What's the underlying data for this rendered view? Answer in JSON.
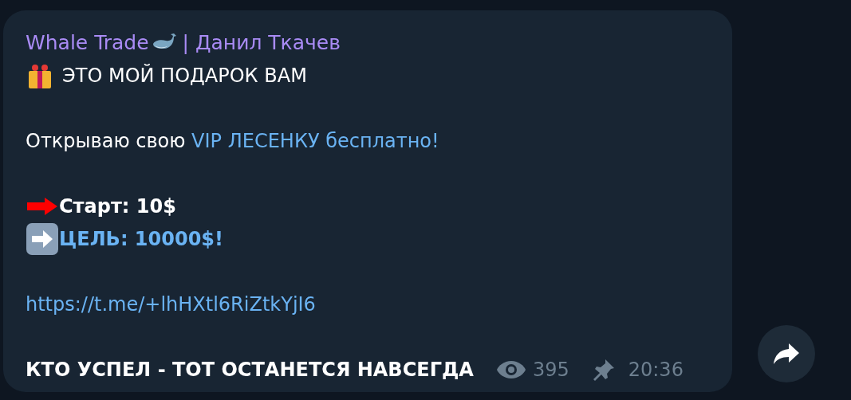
{
  "message": {
    "channel": "Whale Trade",
    "author": "| Данил Ткачев",
    "lines": [
      {
        "kind": "gift",
        "text": "ЭТО МОЙ ПОДАРОК ВАМ"
      },
      {
        "kind": "blank"
      },
      {
        "kind": "mixed",
        "text": "Открываю свою",
        "link": "VIP ЛЕСЕНКУ бесплатно!"
      },
      {
        "kind": "blank"
      },
      {
        "kind": "start",
        "text": "Старт: 10$"
      },
      {
        "kind": "goal",
        "text": "ЦЕЛЬ: 10000$!"
      },
      {
        "kind": "blank"
      },
      {
        "kind": "url",
        "text": "https://t.me/+lhHXtl6RiZtkYjI6"
      },
      {
        "kind": "blank"
      }
    ],
    "last_line": "КТО УСПЕЛ - ТОТ ОСТАНЕТСЯ НАВСЕГДА",
    "views": "395",
    "pinned": true,
    "time": "20:36"
  }
}
